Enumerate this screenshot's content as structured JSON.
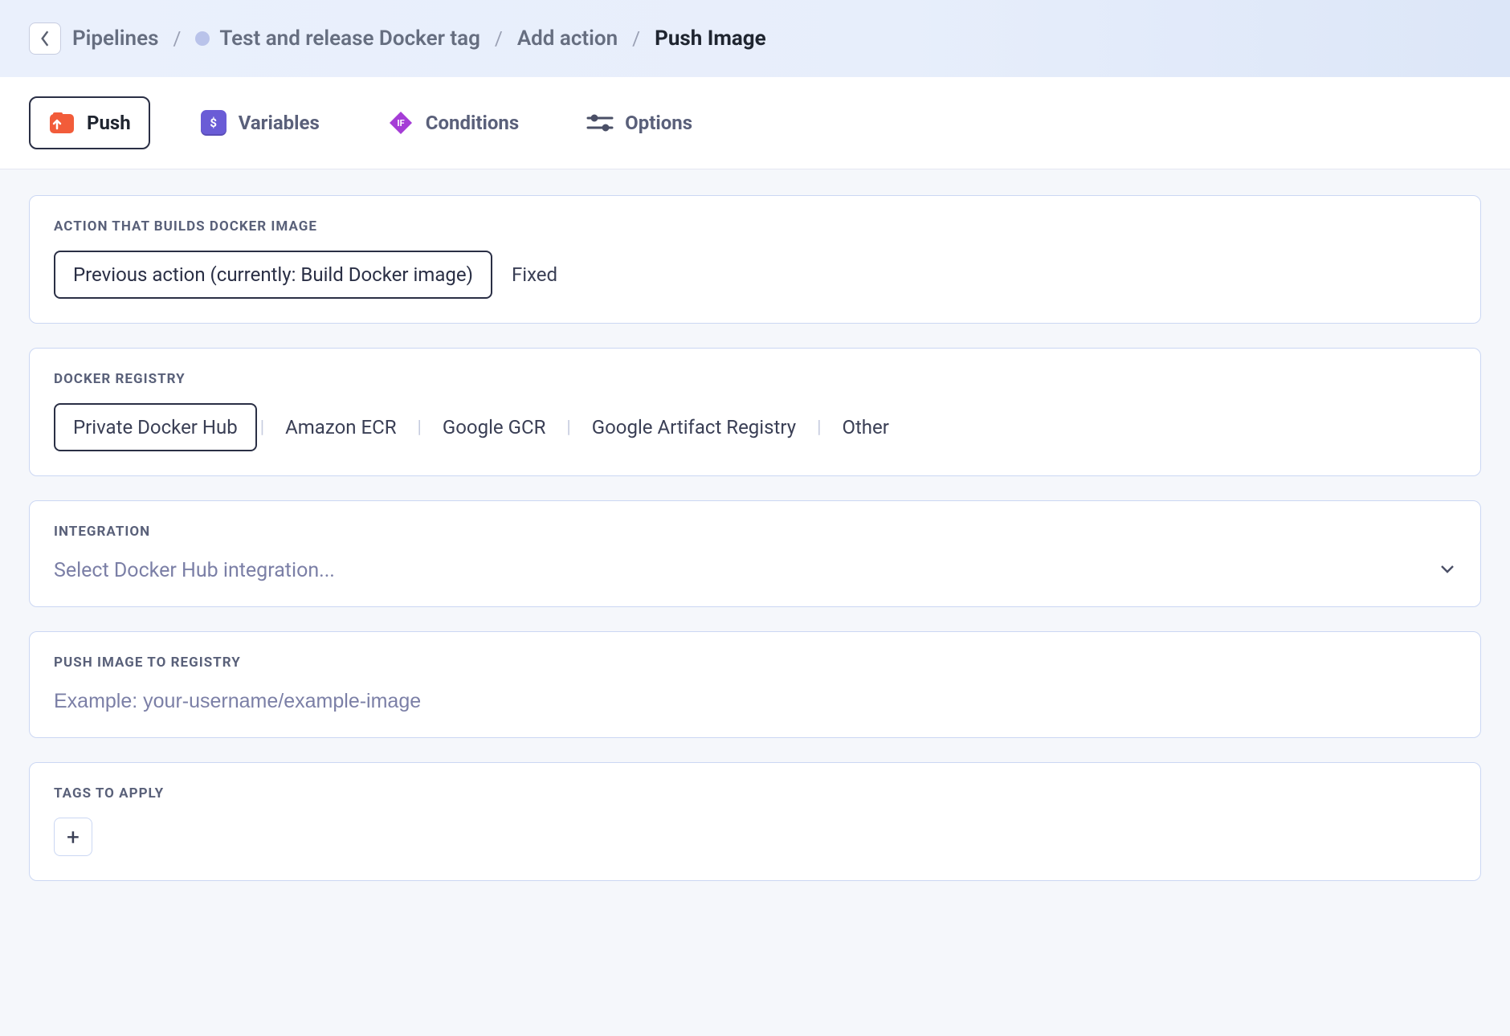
{
  "breadcrumb": {
    "items": [
      {
        "label": "Pipelines"
      },
      {
        "label": "Test and release Docker tag",
        "has_dot": true
      },
      {
        "label": "Add action"
      }
    ],
    "current": "Push Image"
  },
  "tabs": [
    {
      "id": "push",
      "label": "Push",
      "active": true
    },
    {
      "id": "variables",
      "label": "Variables",
      "active": false
    },
    {
      "id": "conditions",
      "label": "Conditions",
      "active": false
    },
    {
      "id": "options",
      "label": "Options",
      "active": false
    }
  ],
  "sections": {
    "build_action": {
      "label": "ACTION THAT BUILDS DOCKER IMAGE",
      "value": "Previous action (currently: Build Docker image)",
      "suffix": "Fixed"
    },
    "registry": {
      "label": "DOCKER REGISTRY",
      "options": [
        "Private Docker Hub",
        "Amazon ECR",
        "Google GCR",
        "Google Artifact Registry",
        "Other"
      ],
      "selected_index": 0
    },
    "integration": {
      "label": "INTEGRATION",
      "placeholder": "Select Docker Hub integration..."
    },
    "push_image": {
      "label": "PUSH IMAGE TO REGISTRY",
      "placeholder": "Example: your-username/example-image",
      "value": ""
    },
    "tags": {
      "label": "TAGS TO APPLY"
    }
  }
}
